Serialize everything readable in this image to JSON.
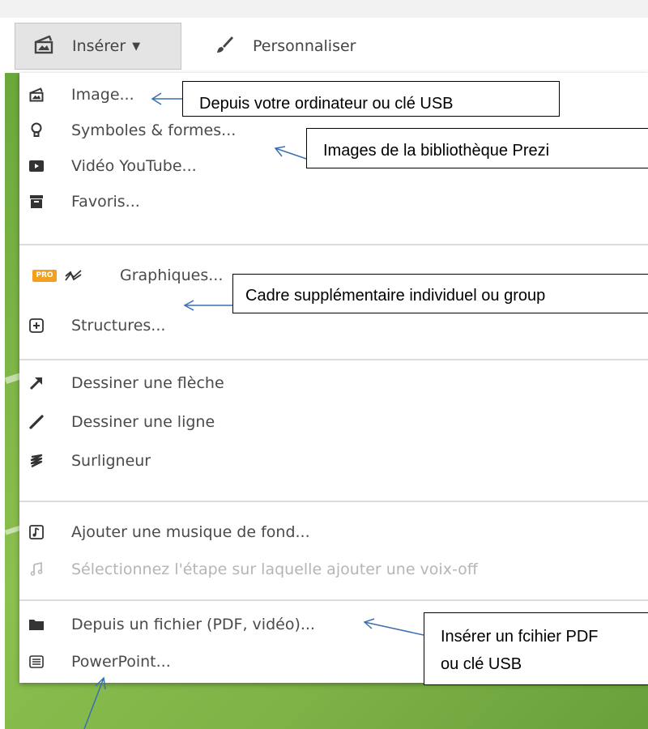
{
  "toolbar": {
    "insert_label": "Insérer",
    "customize_label": "Personnaliser"
  },
  "menu": {
    "group1": [
      {
        "label": "Image...",
        "icon": "image-icon"
      },
      {
        "label": "Symboles & formes...",
        "icon": "lightbulb-icon"
      },
      {
        "label": "Vidéo YouTube...",
        "icon": "youtube-icon"
      },
      {
        "label": "Favoris...",
        "icon": "archive-icon"
      }
    ],
    "pro_badge": "PRO",
    "charts_label": "Graphiques...",
    "structures_label": "Structures...",
    "group3": [
      {
        "label": "Dessiner une flèche",
        "icon": "arrow-icon"
      },
      {
        "label": "Dessiner une ligne",
        "icon": "line-icon"
      },
      {
        "label": "Surligneur",
        "icon": "highlighter-icon"
      }
    ],
    "music_label": "Ajouter une musique de fond...",
    "voiceover_label": "Sélectionnez l'étape sur laquelle ajouter une voix-off",
    "file_label": "Depuis un fichier (PDF, vidéo)...",
    "powerpoint_label": "PowerPoint..."
  },
  "callouts": {
    "image": "Depuis votre ordinateur ou clé USB",
    "symbols": "Images de la bibliothèque Prezi",
    "structures": "Cadre supplémentaire individuel ou group",
    "file_line1": "Insérer un fcihier PDF",
    "file_line2": "ou clé USB"
  },
  "colors": {
    "pro_badge": "#f2a01e",
    "background_green": "#7db347"
  }
}
